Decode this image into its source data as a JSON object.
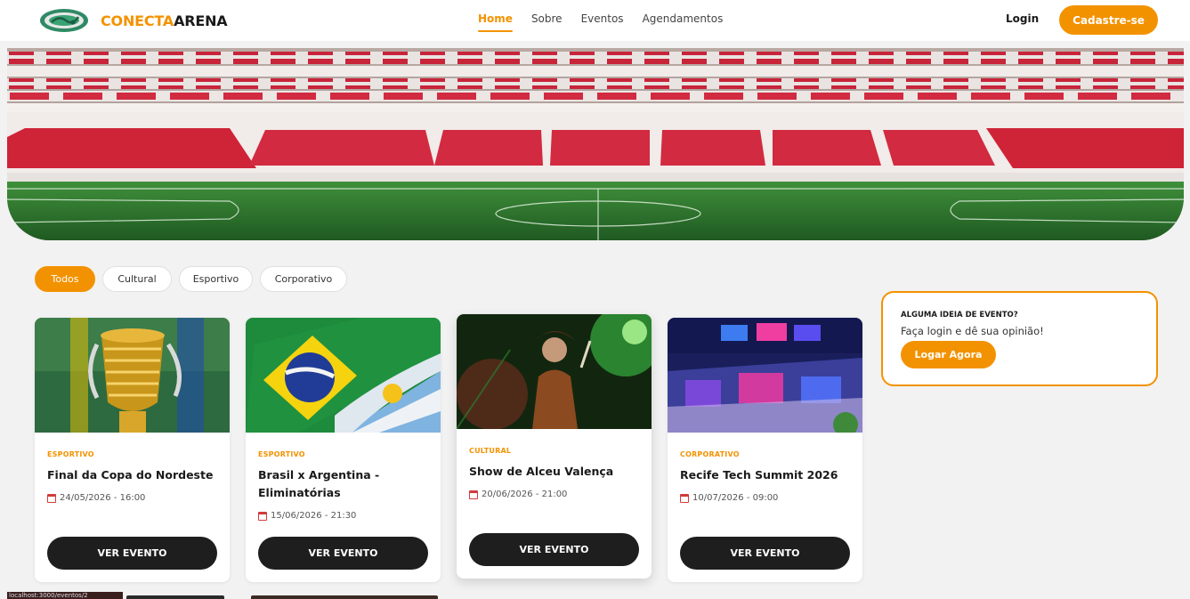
{
  "header": {
    "brand_part1": "CONECTA",
    "brand_part2": "ARENA",
    "logo_icon": "stadium-logo-icon",
    "nav": [
      "Home",
      "Sobre",
      "Eventos",
      "Agendamentos"
    ],
    "active_nav": "Home",
    "login_label": "Login",
    "signup_label": "Cadastre-se"
  },
  "hero": {
    "image": "stadium-hero-image"
  },
  "filters": [
    "Todos",
    "Cultural",
    "Esportivo",
    "Corporativo"
  ],
  "active_filter": "Todos",
  "events": [
    {
      "category": "ESPORTIVO",
      "title": "Final da Copa do Nordeste",
      "date": "24/05/2026 - 16:00",
      "button": "VER EVENTO",
      "image": "trophy-image"
    },
    {
      "category": "ESPORTIVO",
      "title": "Brasil x Argentina - Eliminatórias",
      "date": "15/06/2026 - 21:30",
      "button": "VER EVENTO",
      "image": "flags-image"
    },
    {
      "category": "CULTURAL",
      "title": "Show de Alceu Valença",
      "date": "20/06/2026 - 21:00",
      "button": "VER EVENTO",
      "image": "concert-image"
    },
    {
      "category": "CORPORATIVO",
      "title": "Recife Tech Summit 2026",
      "date": "10/07/2026 - 09:00",
      "button": "VER EVENTO",
      "image": "expo-hall-image"
    }
  ],
  "sidebar_cta": {
    "question": "ALGUMA IDEIA DE EVENTO?",
    "subtitle": "Faça login e dê sua opinião!",
    "button": "Logar Agora"
  },
  "status_url": "localhost:3000/eventos/2",
  "colors": {
    "accent": "#f39200",
    "dark": "#1e1e1e",
    "background": "#f2f2f2"
  }
}
